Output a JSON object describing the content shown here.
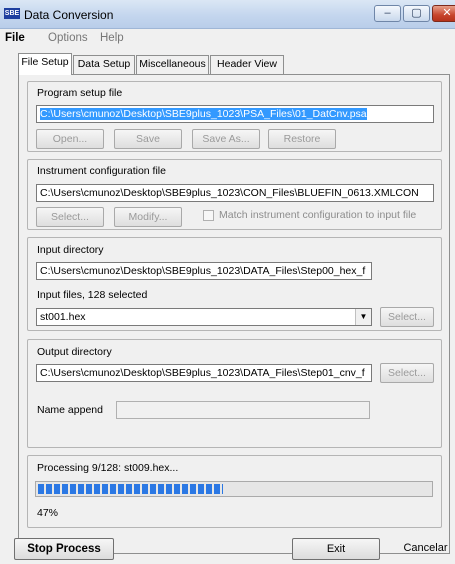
{
  "window": {
    "icon_text": "SBE",
    "title": "Data Conversion",
    "minimize_glyph": "‒",
    "maximize_glyph": "▢",
    "close_glyph": "✕"
  },
  "menu": {
    "file": "File",
    "options": "Options",
    "help": "Help"
  },
  "tabs": [
    {
      "label": "File Setup",
      "active": true
    },
    {
      "label": "Data Setup",
      "active": false
    },
    {
      "label": "Miscellaneous",
      "active": false
    },
    {
      "label": "Header View",
      "active": false
    }
  ],
  "program_setup": {
    "label": "Program setup file",
    "path": "C:\\Users\\cmunoz\\Desktop\\SBE9plus_1023\\PSA_Files\\01_DatCnv.psa",
    "buttons": {
      "open": "Open...",
      "save": "Save",
      "save_as": "Save As...",
      "restore": "Restore"
    }
  },
  "instrument_config": {
    "label": "Instrument configuration file",
    "path": "C:\\Users\\cmunoz\\Desktop\\SBE9plus_1023\\CON_Files\\BLUEFIN_0613.XMLCON",
    "buttons": {
      "select": "Select...",
      "modify": "Modify..."
    },
    "match_checkbox_label": "Match instrument configuration to input file"
  },
  "input": {
    "dir_label": "Input directory",
    "dir_path": "C:\\Users\\cmunoz\\Desktop\\SBE9plus_1023\\DATA_Files\\Step00_hex_f",
    "files_label": "Input files, 128 selected",
    "file_value": "st001.hex",
    "select_button": "Select..."
  },
  "output": {
    "dir_label": "Output directory",
    "dir_path": "C:\\Users\\cmunoz\\Desktop\\SBE9plus_1023\\DATA_Files\\Step01_cnv_f",
    "select_button": "Select...",
    "name_append_label": "Name append",
    "name_append_value": ""
  },
  "processing": {
    "status": "Processing 9/128: st009.hex...",
    "percent_text": "47%",
    "progress": 0.47
  },
  "bottom": {
    "stop_process": "Stop Process",
    "exit": "Exit",
    "cancel": "Cancelar"
  }
}
